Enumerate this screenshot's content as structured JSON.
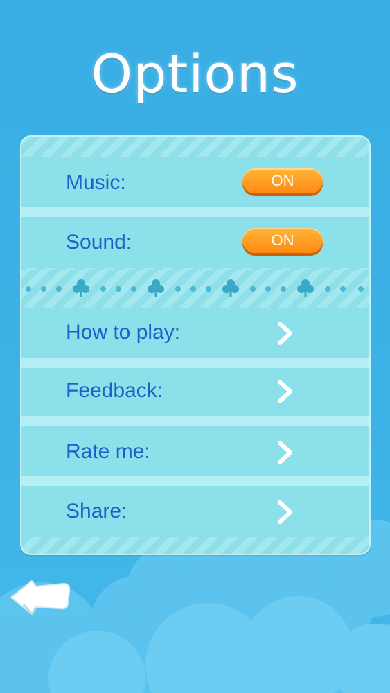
{
  "title": "Options",
  "settings": {
    "music": {
      "label": "Music:",
      "state": "ON"
    },
    "sound": {
      "label": "Sound:",
      "state": "ON"
    }
  },
  "menu": [
    {
      "label": "How to play:",
      "icon": "chevron-right-icon"
    },
    {
      "label": "Feedback:",
      "icon": "chevron-right-icon"
    },
    {
      "label": "Rate me:",
      "icon": "chevron-right-icon"
    },
    {
      "label": "Share:",
      "icon": "chevron-right-icon"
    }
  ],
  "icons": {
    "back": "back-arrow-icon",
    "divider": "clover-icon"
  },
  "colors": {
    "background": "#39aee4",
    "panel": "#8ce0e9",
    "label": "#1f5fc7",
    "toggle": "#ff9a1f"
  }
}
